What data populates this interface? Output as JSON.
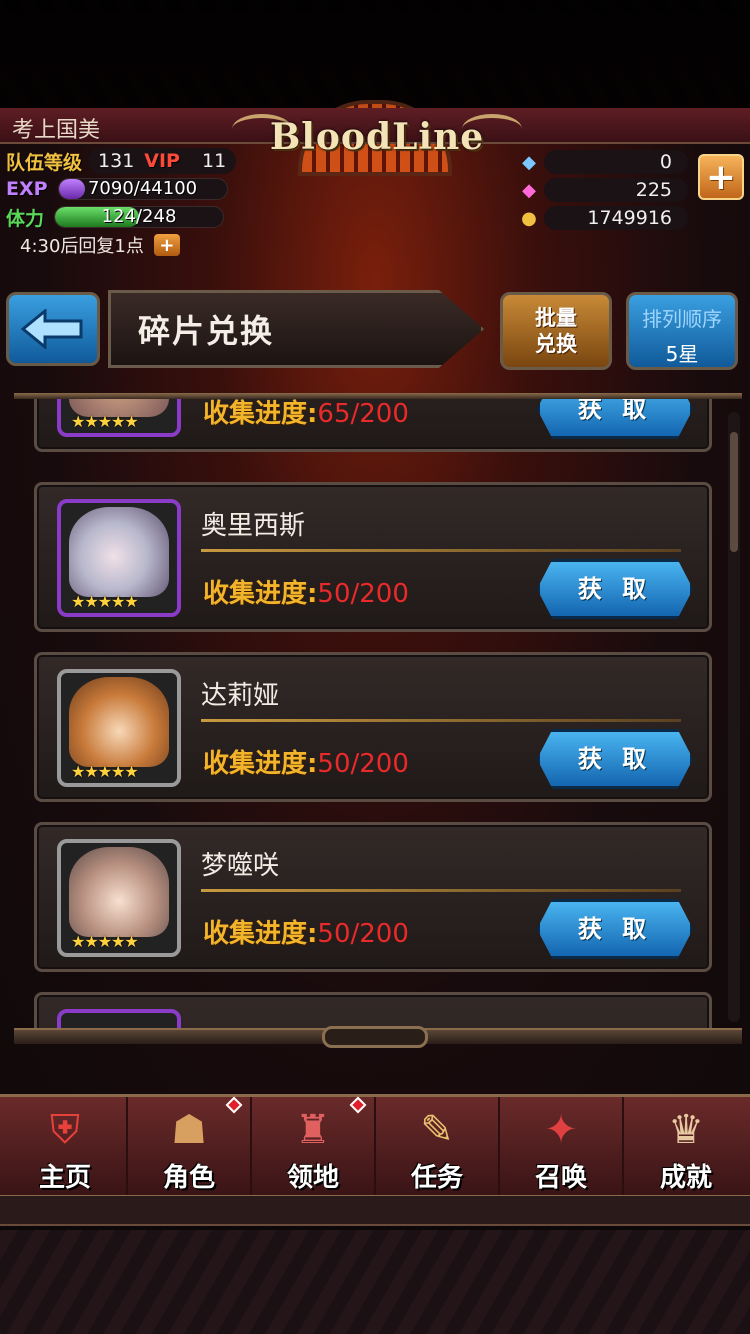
{
  "header": {
    "player_name": "考上国美",
    "logo_text": "BloodLine",
    "team_level_label": "队伍等级",
    "team_level": "131",
    "vip_label": "VIP",
    "vip_level": "11",
    "exp_label": "EXP",
    "exp_text": "7090/44100",
    "exp_progress": 0.16,
    "stamina_label": "体力",
    "stamina_text": "124/248",
    "stamina_progress": 0.5,
    "recover_text": "4:30后回复1点",
    "currencies": [
      {
        "icon": "crystal-icon",
        "value": "0"
      },
      {
        "icon": "gem-icon",
        "value": "225"
      },
      {
        "icon": "gold-coin-icon",
        "value": "1749916"
      }
    ]
  },
  "titlebar": {
    "title": "碎片兑换",
    "batch_label_1": "批量",
    "batch_label_2": "兑换",
    "sort_label": "排列顺序",
    "sort_value": "5星"
  },
  "list": {
    "progress_label": "收集进度:",
    "get_label": "获 取",
    "items": [
      {
        "name": "",
        "progress": "65/200",
        "frame": "purple"
      },
      {
        "name": "奥里西斯",
        "progress": "50/200",
        "frame": "purple"
      },
      {
        "name": "达莉娅",
        "progress": "50/200",
        "frame": "silver"
      },
      {
        "name": "梦噬咲",
        "progress": "50/200",
        "frame": "silver"
      }
    ]
  },
  "nav": {
    "items": [
      {
        "label": "主页",
        "icon": "home-shield-icon",
        "badge": false
      },
      {
        "label": "角色",
        "icon": "character-icon",
        "badge": true
      },
      {
        "label": "领地",
        "icon": "castle-icon",
        "badge": true
      },
      {
        "label": "任务",
        "icon": "quest-book-icon",
        "badge": false
      },
      {
        "label": "召唤",
        "icon": "summon-cards-icon",
        "badge": false
      },
      {
        "label": "成就",
        "icon": "trophy-icon",
        "badge": false
      }
    ]
  },
  "colors": {
    "accent_blue": "#1466b0",
    "progress_red": "#e82a2a",
    "label_gold": "#f2b42a"
  }
}
